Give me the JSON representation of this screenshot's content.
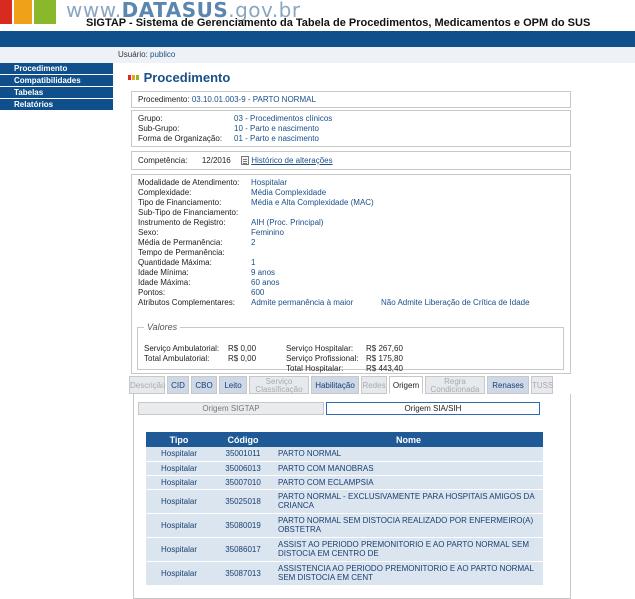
{
  "header": {
    "logo_text_a": "www.",
    "logo_text_b": "DATASUS",
    "logo_text_c": ".gov.br",
    "title": "SIGTAP - Sistema de Gerenciamento da Tabela de Procedimentos, Medicamentos e OPM do SUS"
  },
  "nav": {
    "items": [
      "Procedimento",
      "Compatibilidades",
      "Tabelas",
      "Relatórios"
    ]
  },
  "user": {
    "label": "Usuário:",
    "value": "publico"
  },
  "page_title": "Procedimento",
  "procedimento": {
    "label": "Procedimento:",
    "value": "03.10.01.003-9 - PARTO NORMAL"
  },
  "group": [
    {
      "label": "Grupo:",
      "value": "03 - Procedimentos clínicos"
    },
    {
      "label": "Sub-Grupo:",
      "value": "10 - Parto e nascimento"
    },
    {
      "label": "Forma de Organização:",
      "value": "01 - Parto e nascimento"
    }
  ],
  "competencia": {
    "label": "Competência:",
    "value": "12/2016",
    "history_link": "Histórico de alterações"
  },
  "attributes": [
    {
      "label": "Modalidade de Atendimento:",
      "value": "Hospitalar"
    },
    {
      "label": "Complexidade:",
      "value": "Média Complexidade"
    },
    {
      "label": "Tipo de Financiamento:",
      "value": "Média e Alta Complexidade (MAC)"
    },
    {
      "label": "Sub-Tipo de Financiamento:",
      "value": ""
    },
    {
      "label": "Instrumento de Registro:",
      "value": "AIH (Proc. Principal)"
    },
    {
      "label": "Sexo:",
      "value": "Feminino"
    },
    {
      "label": "Média de Permanência:",
      "value": "2"
    },
    {
      "label": "Tempo de Permanência:",
      "value": ""
    },
    {
      "label": "Quantidade Máxima:",
      "value": "1"
    },
    {
      "label": "Idade Mínima:",
      "value": "9 anos"
    },
    {
      "label": "Idade Máxima:",
      "value": "60 anos"
    },
    {
      "label": "Pontos:",
      "value": "600"
    },
    {
      "label": "Atributos Complementares:",
      "value": "Admite permanência à maior",
      "value2": "Não Admite Liberação de Crítica de Idade"
    }
  ],
  "valores": {
    "legend": "Valores",
    "left": [
      {
        "label": "Serviço Ambulatorial:",
        "value": "R$ 0,00"
      },
      {
        "label": "Total Ambulatorial:",
        "value": "R$ 0,00"
      }
    ],
    "right": [
      {
        "label": "Serviço Hospitalar:",
        "value": "R$ 267,60"
      },
      {
        "label": "Serviço Profissional:",
        "value": "R$ 175,80"
      },
      {
        "label": "Total Hospitalar:",
        "value": "R$ 443,40"
      }
    ]
  },
  "tabs": [
    {
      "label": "Descrição",
      "state": "disabled"
    },
    {
      "label": "CID",
      "state": "on"
    },
    {
      "label": "CBO",
      "state": "on"
    },
    {
      "label": "Leito",
      "state": "on"
    },
    {
      "label": "Serviço Classificação",
      "state": "disabled"
    },
    {
      "label": "Habilitação",
      "state": "on"
    },
    {
      "label": "Redes",
      "state": "disabled"
    },
    {
      "label": "Origem",
      "state": "selected"
    },
    {
      "label": "Regra Condicionada",
      "state": "disabled"
    },
    {
      "label": "Renases",
      "state": "on"
    },
    {
      "label": "TUSS",
      "state": "disabled"
    }
  ],
  "subtabs": [
    "Origem SIGTAP",
    "Origem SIA/SIH"
  ],
  "table": {
    "headers": [
      "Tipo",
      "Código",
      "Nome"
    ],
    "rows": [
      [
        "Hospitalar",
        "35001011",
        "PARTO NORMAL"
      ],
      [
        "Hospitalar",
        "35006013",
        "PARTO COM MANOBRAS"
      ],
      [
        "Hospitalar",
        "35007010",
        "PARTO COM ECLAMPSIA"
      ],
      [
        "Hospitalar",
        "35025018",
        "PARTO NORMAL - EXCLUSIVAMENTE PARA HOSPITAIS AMIGOS DA CRIANCA"
      ],
      [
        "Hospitalar",
        "35080019",
        "PARTO NORMAL SEM DISTOCIA REALIZADO POR ENFERMEIRO(A) OBSTETRA"
      ],
      [
        "Hospitalar",
        "35086017",
        "ASSIST AO PERIODO PREMONITORIO E AO PARTO NORMAL SEM DISTOCIA EM CENTRO DE"
      ],
      [
        "Hospitalar",
        "35087013",
        "ASSISTENCIA AO PERIODO PREMONITORIO E AO PARTO NORMAL SEM DISTOCIA EM CENT"
      ]
    ]
  },
  "colors": {
    "brand_blue": "#0f4f8c",
    "link_blue": "#1a4f8a",
    "table_header": "#1f5a96",
    "table_row": "#dbe5f0"
  }
}
